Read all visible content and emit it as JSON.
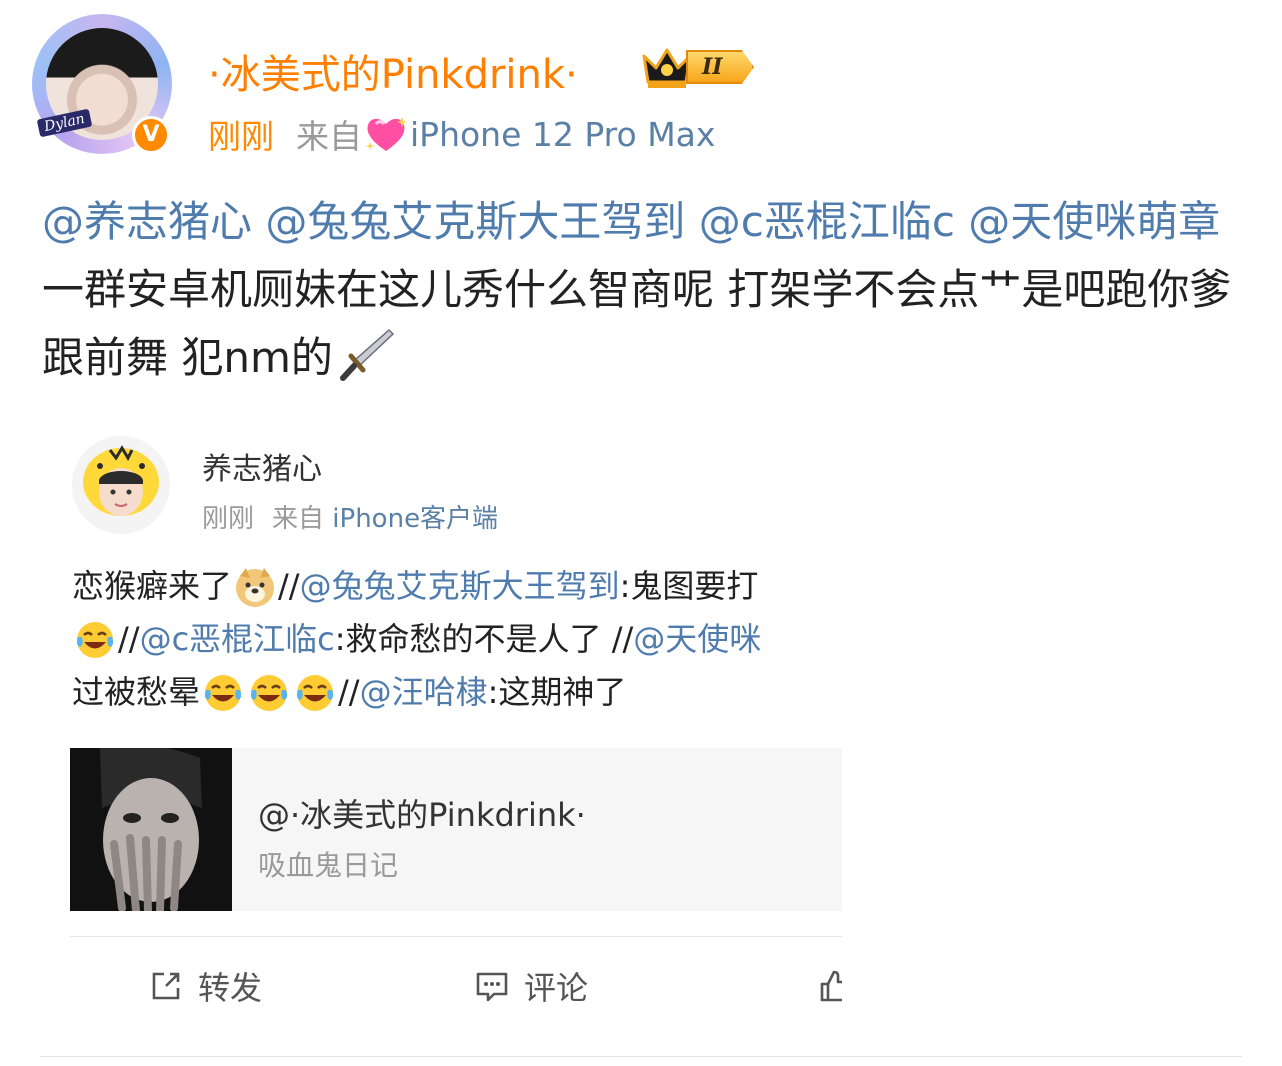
{
  "header": {
    "username": "·冰美式的Pinkdrink·",
    "level_badge": "II",
    "time": "刚刚",
    "from_label": "来自",
    "device": "iPhone 12 Pro Max",
    "avatar_tag": "Dylan",
    "verified_mark": "V"
  },
  "post": {
    "segments": [
      {
        "text": "@养志猪心",
        "mention": true
      },
      {
        "text": " ",
        "mention": false
      },
      {
        "text": "@兔兔艾克斯大王驾到",
        "mention": true
      },
      {
        "text": " ",
        "mention": false
      },
      {
        "text": "@c恶棍江临c",
        "mention": true
      },
      {
        "text": " ",
        "mention": false
      },
      {
        "text": "@天使咪萌章",
        "mention": true
      },
      {
        "text": " 一群安卓机厕妹在这儿秀什么智商呢 打架学不会点艹是吧跑你爹跟前舞 犯nm的",
        "mention": false
      }
    ]
  },
  "repost": {
    "author": "养志猪心",
    "time": "刚刚",
    "from_label": "来自",
    "device": "iPhone客户端",
    "lines": {
      "line1_a": "恋猴癖来了",
      "line1_b": "//",
      "line1_mention": "@兔兔艾克斯大王驾到",
      "line1_c": ":鬼图要打",
      "line2_a": "//",
      "line2_mention": "@c恶棍江临c",
      "line2_b": ":救命愁的不是人了 //",
      "line2_mention2": "@天使咪",
      "line3_a": "过被愁晕",
      "line3_b": "//",
      "line3_mention": "@汪哈棣",
      "line3_c": ":这期神了"
    },
    "quoted": {
      "title": "@·冰美式的Pinkdrink·",
      "subtitle": "吸血鬼日记"
    },
    "actions": {
      "forward": "转发",
      "comment": "评论"
    }
  },
  "colors": {
    "username": "#ff7f00",
    "mention": "#4f7cad",
    "muted": "#9a9a9a"
  }
}
